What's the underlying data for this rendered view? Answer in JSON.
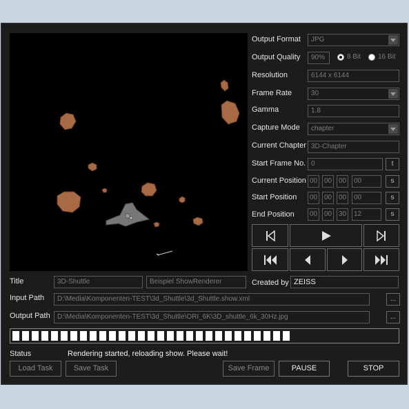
{
  "settings": {
    "output_format": {
      "label": "Output Format",
      "value": "JPG"
    },
    "output_quality": {
      "label": "Output Quality",
      "value": "90%",
      "bit8": "8 Bit",
      "bit16": "16 Bit",
      "selected": "8 Bit"
    },
    "resolution": {
      "label": "Resolution",
      "value": "6144 x 6144"
    },
    "frame_rate": {
      "label": "Frame Rate",
      "value": "30"
    },
    "gamma": {
      "label": "Gamma",
      "value": "1.8"
    },
    "capture_mode": {
      "label": "Capture Mode",
      "value": "chapter"
    },
    "current_chapter": {
      "label": "Current Chapter",
      "value": "3D-Chapter"
    },
    "start_frame": {
      "label": "Start Frame No.",
      "value": "0",
      "button": "t"
    },
    "current_position": {
      "label": "Current Position",
      "h": "00",
      "m": "00",
      "s": "00",
      "f": "00",
      "button": "s"
    },
    "start_position": {
      "label": "Start Position",
      "h": "00",
      "m": "00",
      "s": "00",
      "f": "00",
      "button": "s"
    },
    "end_position": {
      "label": "End Position",
      "h": "00",
      "m": "00",
      "s": "30",
      "f": "12",
      "button": "s"
    }
  },
  "title": {
    "label": "Title",
    "value1": "3D-Shuttle",
    "value2": "Beispiel ShowRenderer",
    "created_by_label": "Created by",
    "created_by": "ZEISS"
  },
  "input_path": {
    "label": "Input Path",
    "value": "D:\\Media\\Komponenten-TEST\\3d_Shuttle\\3d_Shuttle.show.xml",
    "browse": "..."
  },
  "output_path": {
    "label": "Output Path",
    "value": "D:\\Media\\Komponenten-TEST\\3d_Shuttle\\ORI_6K\\3D_shuttle_6k_30Hz.jpg",
    "browse": "..."
  },
  "progress": {
    "fraction": 0.74
  },
  "status": {
    "label": "Status",
    "text": "Rendering started, reloading show. Please wait!"
  },
  "buttons": {
    "load_task": "Load Task",
    "save_task": "Save Task",
    "save_frame": "Save Frame",
    "pause": "PAUSE",
    "stop": "STOP"
  },
  "colors": {
    "window_bg": "#1c1c1c",
    "desktop_bg": "#c8d4e0",
    "asteroid": "#a86a45"
  }
}
